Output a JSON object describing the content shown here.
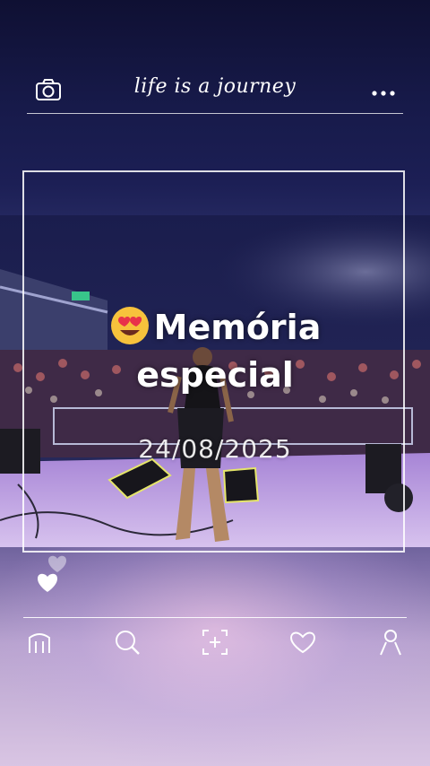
{
  "header": {
    "title": "life is a journey",
    "camera_icon": "camera-icon",
    "more_icon": "more-dots-icon"
  },
  "post": {
    "emoji": "heart-eyes-emoji",
    "caption_line1": "Memória",
    "caption_line2": "especial",
    "date": "24/08/2025"
  },
  "reactions": {
    "icon": "double-heart-icon"
  },
  "bottom_nav": {
    "items": [
      {
        "icon": "home-icon"
      },
      {
        "icon": "search-icon"
      },
      {
        "icon": "add-post-icon"
      },
      {
        "icon": "heart-icon"
      },
      {
        "icon": "profile-icon"
      }
    ]
  },
  "colors": {
    "background_top": "#0f1033",
    "background_bottom": "#d9c5e3",
    "stage_purple": "#8e63c9",
    "accent_white": "#ffffff"
  }
}
